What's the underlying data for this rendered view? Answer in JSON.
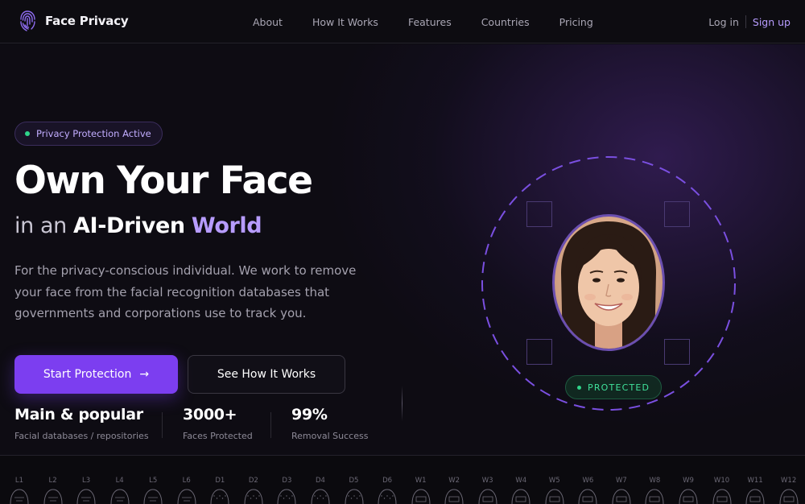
{
  "header": {
    "brand": "Face Privacy",
    "nav": [
      "About",
      "How It Works",
      "Features",
      "Countries",
      "Pricing"
    ],
    "login": "Log in",
    "signup": "Sign up"
  },
  "hero": {
    "badge": "Privacy Protection Active",
    "title": "Own Your Face",
    "subtitle_prefix": "in an",
    "subtitle_strong": "AI-Driven",
    "subtitle_accent": "World",
    "description": "For the privacy-conscious individual. We work to remove your face from the facial recognition databases that governments and corporations use to track you.",
    "primary_button": "Start Protection",
    "primary_button_arrow": "→",
    "secondary_button": "See How It Works",
    "stats": [
      {
        "value": "Main & popular",
        "label": "Facial databases / repositories"
      },
      {
        "value": "3000+",
        "label": "Faces Protected"
      },
      {
        "value": "99%",
        "label": "Removal Success"
      }
    ],
    "status_badge": "PROTECTED"
  },
  "strip": {
    "labels": [
      "L1",
      "L2",
      "L3",
      "L4",
      "L5",
      "L6",
      "D1",
      "D2",
      "D3",
      "D4",
      "D5",
      "D6",
      "W1",
      "W2",
      "W3",
      "W4",
      "W5",
      "W6",
      "W7",
      "W8",
      "W9",
      "W10",
      "W11",
      "W12"
    ]
  },
  "colors": {
    "accent": "#7c3ef0",
    "accent_light": "#b79cff",
    "status_green": "#2fd48a",
    "background": "#0c0b10"
  },
  "icons": {
    "logo": "face-fingerprint-icon",
    "arrow": "arrow-right-icon",
    "status_dot": "green-dot-icon"
  }
}
